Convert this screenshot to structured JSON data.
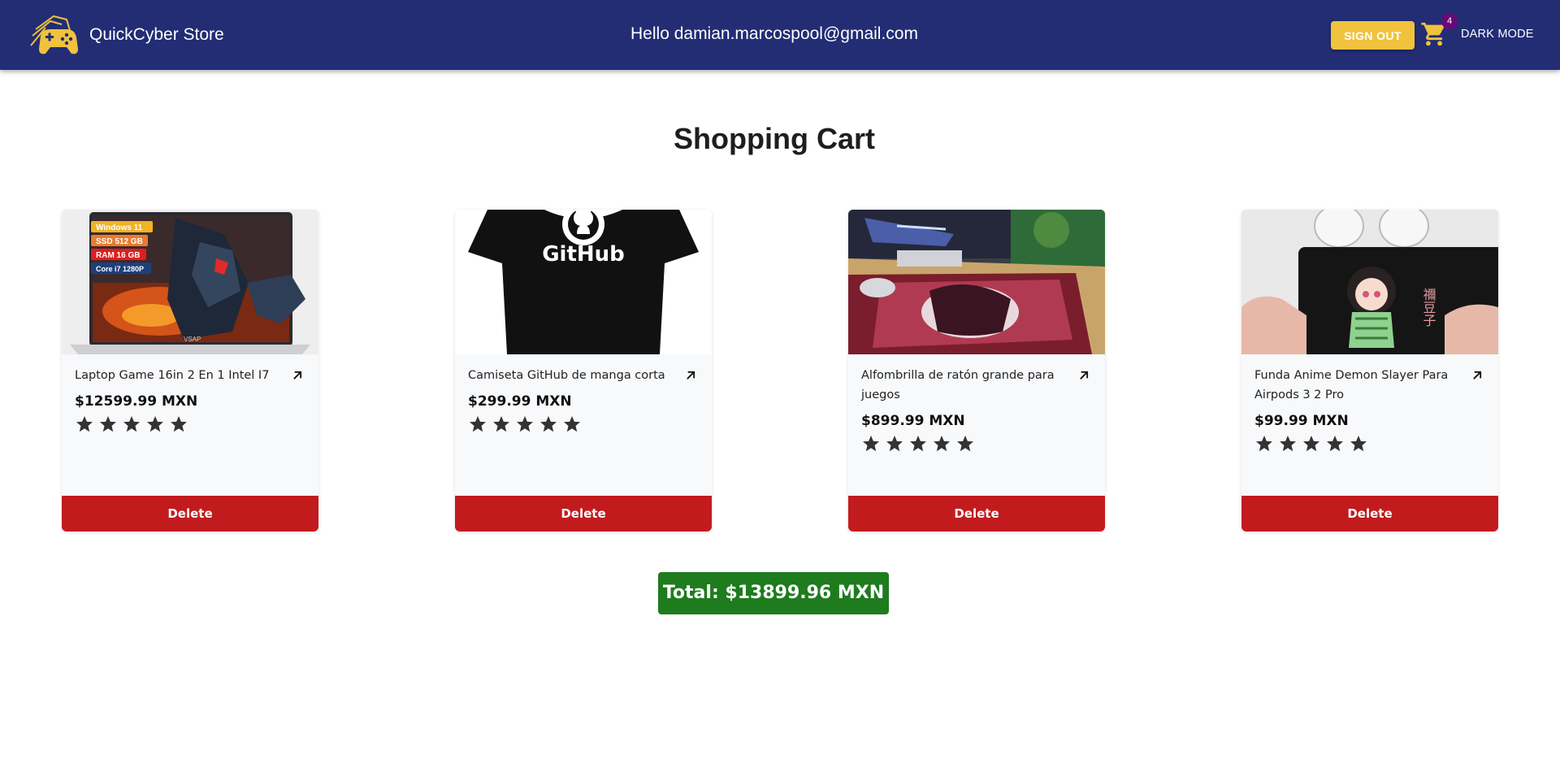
{
  "header": {
    "brand_name": "QuickCyber Store",
    "greeting": "Hello damian.marcospool@gmail.com",
    "signout_label": "SIGN OUT",
    "cart_count": "4",
    "darkmode_label": "DARK MODE",
    "bar_color": "#222d74",
    "accent_color": "#f0c23d"
  },
  "main": {
    "title": "Shopping Cart",
    "items": [
      {
        "name": "Laptop Game 16in 2 En 1 Intel I7",
        "price": "$12599.99 MXN",
        "rating": 5,
        "delete_label": "Delete",
        "image_labels": [
          "Windows 11",
          "SSD 512 GB",
          "RAM 16 GB",
          "Core i7 1280P"
        ],
        "image_brand": "VSAP"
      },
      {
        "name": "Camiseta GitHub de manga corta",
        "price": "$299.99 MXN",
        "rating": 5,
        "delete_label": "Delete",
        "image_text": "GitHub"
      },
      {
        "name": "Alfombrilla de ratón grande para juegos",
        "price": "$899.99 MXN",
        "rating": 5,
        "delete_label": "Delete"
      },
      {
        "name": "Funda Anime Demon Slayer Para Airpods 3 2 Pro",
        "price": "$99.99 MXN",
        "rating": 5,
        "delete_label": "Delete",
        "image_text": "禰豆子"
      }
    ],
    "total": "Total: $13899.96 MXN",
    "delete_color": "#c21b1e",
    "total_color": "#1e7b1e"
  }
}
